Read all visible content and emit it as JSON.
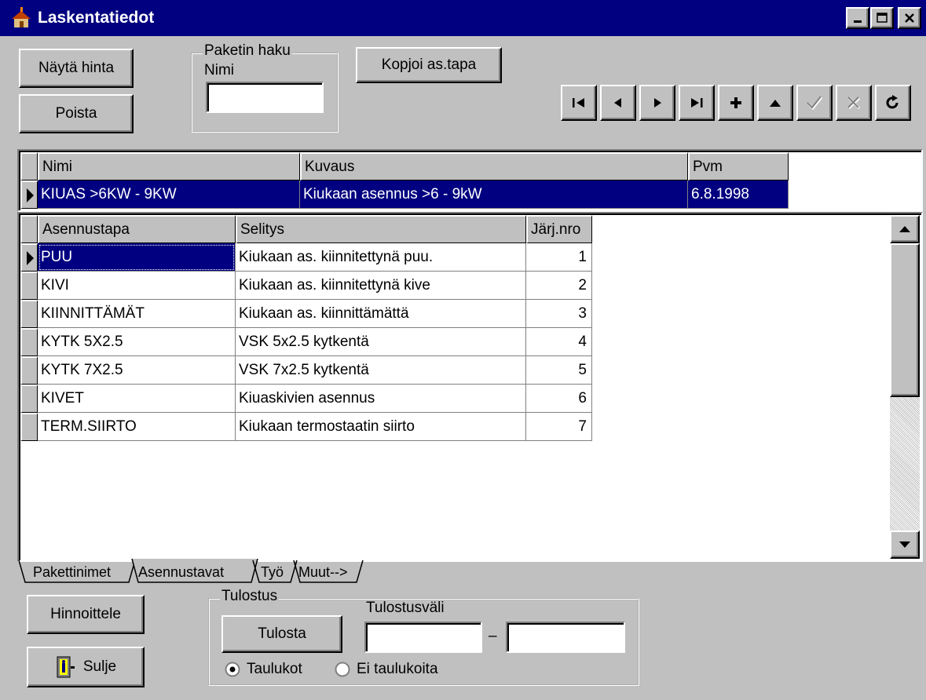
{
  "window": {
    "title": "Laskentatiedot",
    "controls": [
      "minimize",
      "maximize",
      "close"
    ]
  },
  "toolbar": {
    "show_price_label": "Näytä hinta",
    "delete_label": "Poista",
    "copy_label": "Kopjoi as.tapa",
    "package_search": {
      "group_label": "Paketin haku",
      "name_label": "Nimi",
      "value": ""
    },
    "navigator": [
      "first",
      "prior",
      "next",
      "last",
      "insert",
      "delete",
      "post",
      "cancel",
      "refresh"
    ]
  },
  "package_grid": {
    "columns": [
      "Nimi",
      "Kuvaus",
      "Pvm"
    ],
    "rows": [
      {
        "nimi": "KIUAS >6KW - 9KW",
        "kuvaus": "Kiukaan asennus >6 - 9kW",
        "pvm": "6.8.1998"
      }
    ]
  },
  "method_grid": {
    "columns": [
      "Asennustapa",
      "Selitys",
      "Järj.nro"
    ],
    "rows": [
      {
        "tapa": "PUU",
        "selitys": "Kiukaan as. kiinnitettynä puu.",
        "nro": "1"
      },
      {
        "tapa": "KIVI",
        "selitys": "Kiukaan as. kiinnitettynä kive",
        "nro": "2"
      },
      {
        "tapa": "KIINNITTÄMÄT",
        "selitys": "Kiukaan as. kiinnittämättä",
        "nro": "3"
      },
      {
        "tapa": "KYTK 5X2.5",
        "selitys": "VSK 5x2.5 kytkentä",
        "nro": "4"
      },
      {
        "tapa": "KYTK 7X2.5",
        "selitys": "VSK 7x2.5 kytkentä",
        "nro": "5"
      },
      {
        "tapa": "KIVET",
        "selitys": "Kiuaskivien asennus",
        "nro": "6"
      },
      {
        "tapa": "TERM.SIIRTO",
        "selitys": "Kiukaan termostaatin siirto",
        "nro": "7"
      }
    ]
  },
  "tabs": [
    "Pakettinimet",
    "Asennustavat",
    "Työ",
    "Muut-->"
  ],
  "active_tab": "Asennustavat",
  "bottom": {
    "price_label": "Hinnoittele",
    "close_label": "Sulje",
    "print_group": {
      "group_label": "Tulostus",
      "print_label": "Tulosta",
      "range_label": "Tulostusväli",
      "range_separator": "–",
      "range_from": "",
      "range_to": "",
      "radio_tables": "Taulukot",
      "radio_no_tables": "Ei taulukoita",
      "selected": "Taulukot"
    }
  }
}
